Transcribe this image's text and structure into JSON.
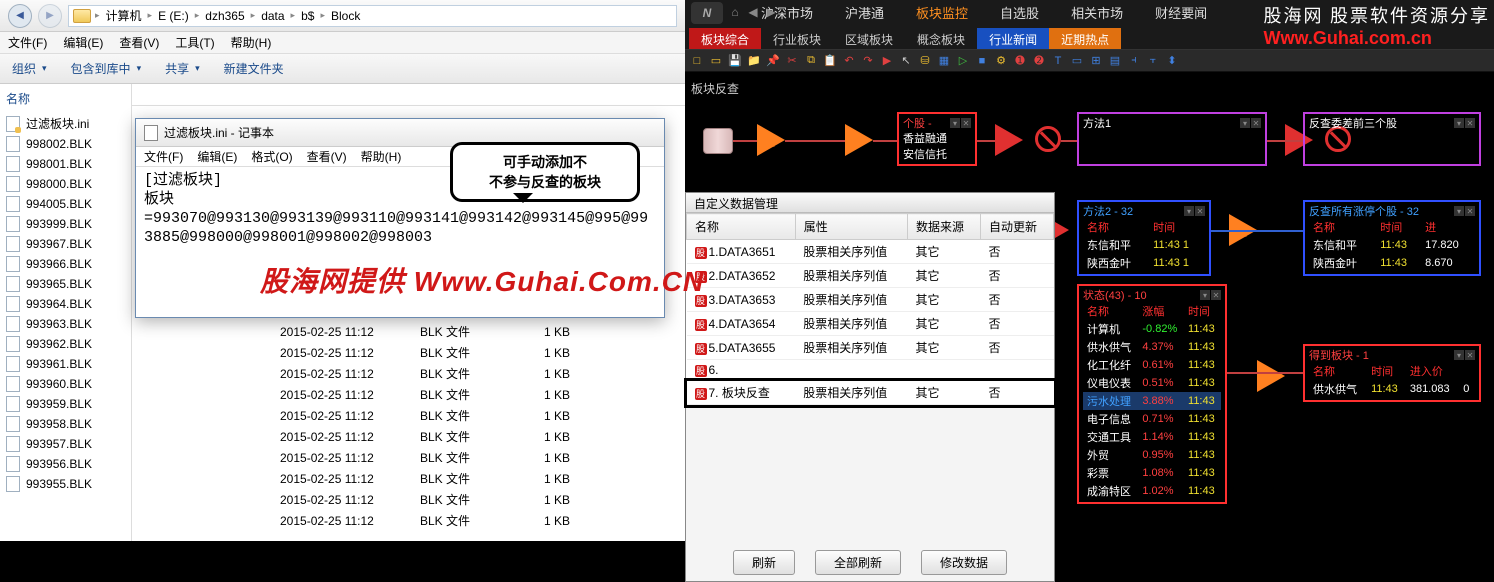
{
  "explorer": {
    "breadcrumb": [
      "计算机",
      "E (E:)",
      "dzh365",
      "data",
      "b$",
      "Block"
    ],
    "menu": [
      "文件(F)",
      "编辑(E)",
      "查看(V)",
      "工具(T)",
      "帮助(H)"
    ],
    "toolbar": {
      "organize": "组织",
      "include": "包含到库中",
      "share": "共享",
      "newfolder": "新建文件夹"
    },
    "sidebar_header": "名称",
    "file_ini": "过滤板块.ini",
    "files": [
      "998002.BLK",
      "998001.BLK",
      "998000.BLK",
      "994005.BLK",
      "993999.BLK",
      "993967.BLK",
      "993966.BLK",
      "993965.BLK",
      "993964.BLK",
      "993963.BLK",
      "993962.BLK",
      "993961.BLK",
      "993960.BLK",
      "993959.BLK",
      "993958.BLK",
      "993957.BLK",
      "993956.BLK",
      "993955.BLK"
    ],
    "row_date": "2015-02-25 11:12",
    "row_type": "BLK 文件",
    "row_size": "1 KB",
    "partial_date": "2015-02-25 11:12"
  },
  "notepad": {
    "title": "过滤板块.ini - 记事本",
    "menu": [
      "文件(F)",
      "编辑(E)",
      "格式(O)",
      "查看(V)",
      "帮助(H)"
    ],
    "content": "[过滤板块]\n板块\n=993070@993130@993139@993110@993141@993142@993145@995@993885@998000@998001@998002@998003"
  },
  "callout": {
    "l1": "可手动添加不",
    "l2": "不参与反查的板块"
  },
  "watermark": "股海网提供 Www.Guhai.Com.CN",
  "app": {
    "tabs": [
      "沪深市场",
      "沪港通",
      "板块监控",
      "自选股",
      "相关市场",
      "财经要闻"
    ],
    "active_tab": 2,
    "subtabs": [
      {
        "label": "板块综合",
        "cls": "red"
      },
      {
        "label": "行业板块",
        "cls": ""
      },
      {
        "label": "区域板块",
        "cls": ""
      },
      {
        "label": "概念板块",
        "cls": ""
      },
      {
        "label": "行业新闻",
        "cls": "blue"
      },
      {
        "label": "近期热点",
        "cls": "orange"
      }
    ],
    "ws_title": "板块反查",
    "cdm": {
      "title": "自定义数据管理",
      "headers": [
        "名称",
        "属性",
        "数据来源",
        "自动更新"
      ],
      "rows": [
        {
          "n": "1.DATA3651",
          "a": "股票相关序列值",
          "s": "其它",
          "u": "否"
        },
        {
          "n": "2.DATA3652",
          "a": "股票相关序列值",
          "s": "其它",
          "u": "否"
        },
        {
          "n": "3.DATA3653",
          "a": "股票相关序列值",
          "s": "其它",
          "u": "否"
        },
        {
          "n": "4.DATA3654",
          "a": "股票相关序列值",
          "s": "其它",
          "u": "否"
        },
        {
          "n": "5.DATA3655",
          "a": "股票相关序列值",
          "s": "其它",
          "u": "否"
        },
        {
          "n": "6.",
          "a": "",
          "s": "",
          "u": ""
        },
        {
          "n": "7. 板块反查",
          "a": "股票相关序列值",
          "s": "其它",
          "u": "否",
          "hl": true
        }
      ],
      "btns": [
        "刷新",
        "全部刷新",
        "修改数据"
      ]
    },
    "blocks": {
      "gegu": {
        "title": "个股 -",
        "rows": [
          "香益融通",
          "安信信托"
        ]
      },
      "ff1": {
        "title": "方法1"
      },
      "fc3": {
        "title": "反查委差前三个股"
      },
      "ff2": {
        "title": "方法2 - 32",
        "head": [
          "名称",
          "时间"
        ],
        "rows": [
          [
            "东信和平",
            "11:43 1"
          ],
          [
            "陕西金叶",
            "11:43 1"
          ]
        ]
      },
      "fczt": {
        "title": "反查所有涨停个股 - 32",
        "head": [
          "名称",
          "时间",
          "进"
        ],
        "rows": [
          [
            "东信和平",
            "11:43",
            "17.820"
          ],
          [
            "陕西金叶",
            "11:43",
            "8.670"
          ]
        ]
      },
      "status": {
        "title": "状态(43) - 10",
        "head": [
          "名称",
          "涨幅",
          "时间"
        ],
        "rows": [
          [
            "计算机",
            "-0.82%",
            "11:43"
          ],
          [
            "供水供气",
            "4.37%",
            "11:43"
          ],
          [
            "化工化纤",
            "0.61%",
            "11:43"
          ],
          [
            "仪电仪表",
            "0.51%",
            "11:43"
          ],
          [
            "污水处理",
            "3.88%",
            "11:43"
          ],
          [
            "电子信息",
            "0.71%",
            "11:43"
          ],
          [
            "交通工具",
            "1.14%",
            "11:43"
          ],
          [
            "外贸",
            "0.95%",
            "11:43"
          ],
          [
            "彩票",
            "1.08%",
            "11:43"
          ],
          [
            "成渝特区",
            "1.02%",
            "11:43"
          ]
        ]
      },
      "ddbk": {
        "title": "得到板块 - 1",
        "head": [
          "名称",
          "时间",
          "进入价"
        ],
        "rows": [
          [
            "供水供气",
            "11:43",
            "381.083",
            "0"
          ]
        ]
      }
    },
    "wm": {
      "l1": "股海网 股票软件资源分享",
      "l2": "Www.Guhai.com.cn"
    }
  }
}
